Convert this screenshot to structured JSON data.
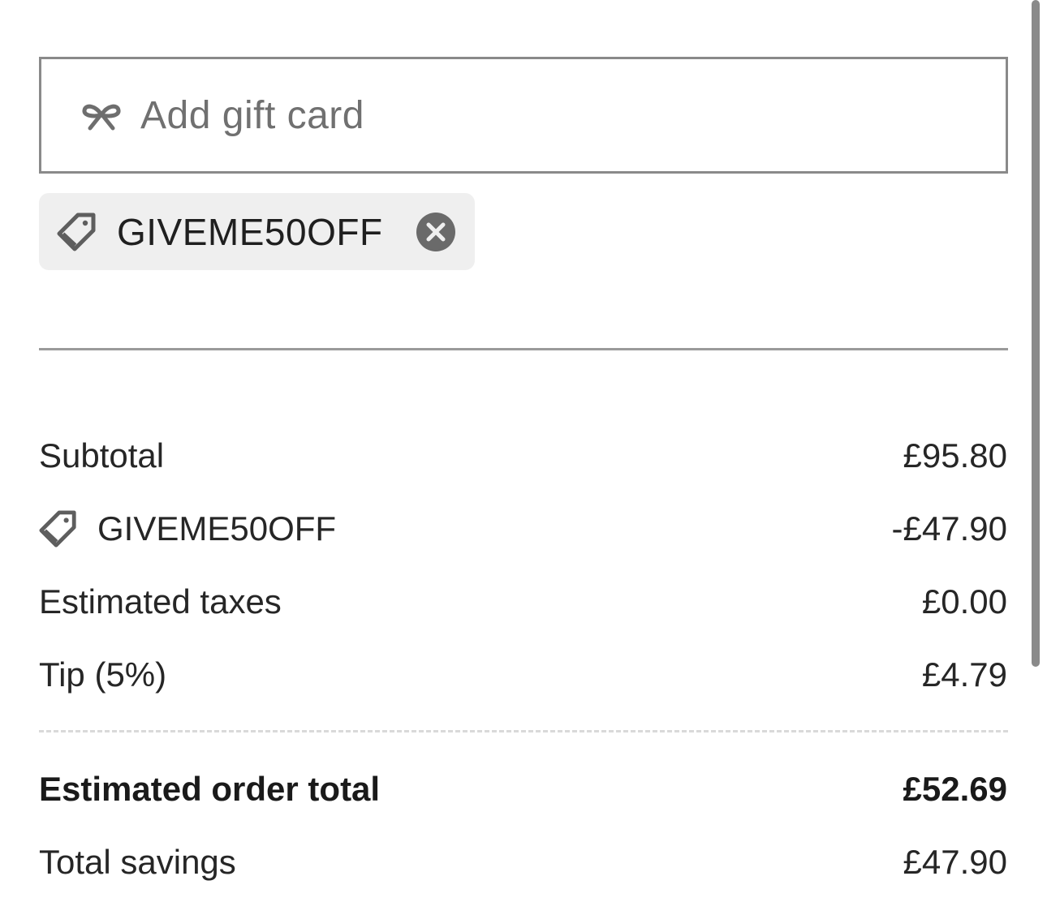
{
  "gift_card": {
    "placeholder": "Add gift card",
    "icon": "gift-bow-icon"
  },
  "applied_code": {
    "code": "GIVEME50OFF",
    "icon": "tag-icon",
    "remove_icon": "close-circle-icon"
  },
  "summary": {
    "subtotal_label": "Subtotal",
    "subtotal_value": "£95.80",
    "discount_label": "GIVEME50OFF",
    "discount_value": "-£47.90",
    "taxes_label": "Estimated taxes",
    "taxes_value": "£0.00",
    "tip_label": "Tip (5%)",
    "tip_value": "£4.79",
    "total_label": "Estimated order total",
    "total_value": "£52.69",
    "savings_label": "Total savings",
    "savings_value": "£47.90"
  },
  "colors": {
    "border": "#8a8a8a",
    "chip_bg": "#efefef",
    "text": "#1f1f1f",
    "placeholder": "#707070"
  }
}
